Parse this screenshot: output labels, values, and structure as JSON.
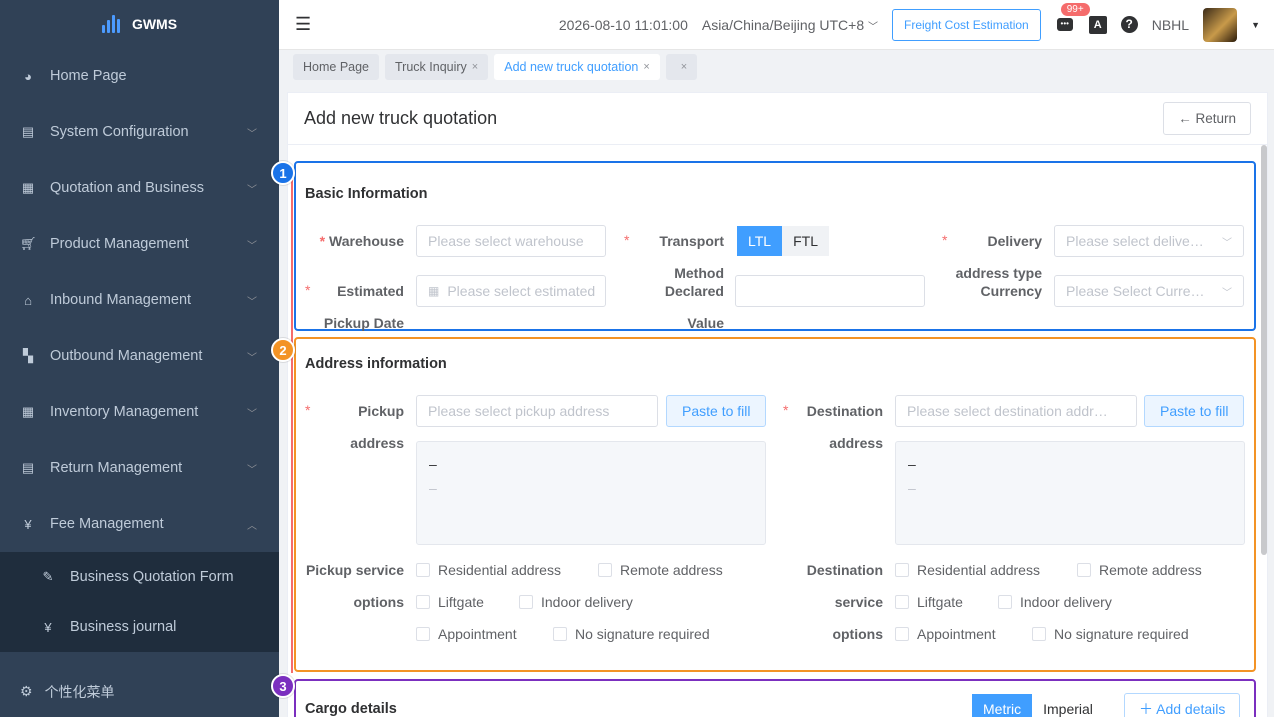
{
  "app": {
    "name": "GWMS"
  },
  "sidebar": {
    "items": [
      {
        "label": "Home Page",
        "icon": "dashboard-icon"
      },
      {
        "label": "System Configuration",
        "icon": "computer-icon"
      },
      {
        "label": "Quotation and Business",
        "icon": "document-icon"
      },
      {
        "label": "Product Management",
        "icon": "cart-icon"
      },
      {
        "label": "Inbound Management",
        "icon": "home-icon"
      },
      {
        "label": "Outbound Management",
        "icon": "grid-icon"
      },
      {
        "label": "Inventory Management",
        "icon": "table-icon"
      },
      {
        "label": "Return Management",
        "icon": "document-icon"
      },
      {
        "label": "Fee Management",
        "icon": "yen-icon"
      }
    ],
    "submenu": [
      {
        "label": "Business Quotation Form",
        "icon": "edit-icon"
      },
      {
        "label": "Business journal",
        "icon": "yen-icon"
      }
    ],
    "bottom": "个性化菜单"
  },
  "header": {
    "datetime": "2026-08-10 11:01:00",
    "timezone": "Asia/China/Beijing UTC+8",
    "freight_button": "Freight Cost Estimation",
    "badge": "99+",
    "user": "NBHL"
  },
  "tabs": [
    {
      "label": "Home Page"
    },
    {
      "label": "Truck Inquiry"
    },
    {
      "label": "Add new truck quotation"
    },
    {
      "label": ""
    }
  ],
  "page": {
    "title": "Add new truck quotation",
    "return": "← Return"
  },
  "basic": {
    "title": "Basic Information",
    "warehouse_label": "Warehouse",
    "warehouse_placeholder": "Please select warehouse",
    "transport_label": "Transport",
    "transport_label2": "Method",
    "ltl": "LTL",
    "ftl": "FTL",
    "delivery_label": "Delivery",
    "delivery_label2": "address type",
    "delivery_placeholder": "Please select delive…",
    "pickup_date_label": "Estimated",
    "pickup_date_label2": "Pickup Date",
    "pickup_date_placeholder": "Please select estimated",
    "declared_label": "Declared",
    "declared_label2": "Value",
    "declared_value": "",
    "currency_label": "Currency",
    "currency_placeholder": "Please Select Curre…"
  },
  "address": {
    "title": "Address information",
    "pickup_label": "Pickup",
    "pickup_label2": "address",
    "pickup_placeholder": "Please select pickup address",
    "paste": "Paste to fill",
    "dest_label": "Destination",
    "dest_label2": "address",
    "dest_placeholder": "Please select destination addr…",
    "box_line1": "–",
    "box_line2": "–",
    "pickup_service_label": "Pickup service",
    "pickup_service_label2": "options",
    "dest_service_label": "Destination",
    "dest_service_label2": "service",
    "dest_service_label3": "options",
    "opt_residential": "Residential address",
    "opt_remote": "Remote address",
    "opt_liftgate": "Liftgate",
    "opt_indoor": "Indoor delivery",
    "opt_appointment": "Appointment",
    "opt_nosig": "No signature required"
  },
  "cargo": {
    "title": "Cargo details",
    "metric": "Metric",
    "imperial": "Imperial",
    "add": "＋ Add details"
  },
  "markers": [
    "1",
    "2",
    "3"
  ],
  "colors": {
    "section1": "#1a73e8",
    "section2": "#f39325",
    "section3": "#7b2fbf",
    "accent": "#409eff",
    "sidebar": "#304156"
  }
}
